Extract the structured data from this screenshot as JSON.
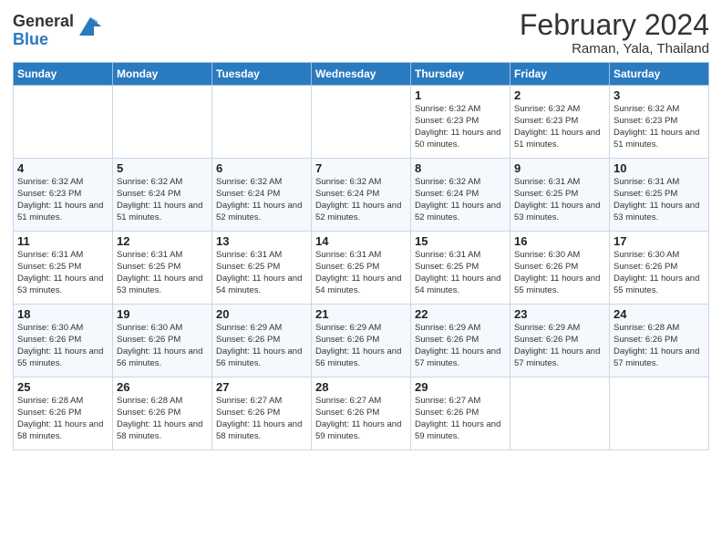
{
  "header": {
    "logo_general": "General",
    "logo_blue": "Blue",
    "month_year": "February 2024",
    "location": "Raman, Yala, Thailand"
  },
  "weekdays": [
    "Sunday",
    "Monday",
    "Tuesday",
    "Wednesday",
    "Thursday",
    "Friday",
    "Saturday"
  ],
  "weeks": [
    [
      {
        "day": "",
        "info": ""
      },
      {
        "day": "",
        "info": ""
      },
      {
        "day": "",
        "info": ""
      },
      {
        "day": "",
        "info": ""
      },
      {
        "day": "1",
        "info": "Sunrise: 6:32 AM\nSunset: 6:23 PM\nDaylight: 11 hours\nand 50 minutes."
      },
      {
        "day": "2",
        "info": "Sunrise: 6:32 AM\nSunset: 6:23 PM\nDaylight: 11 hours\nand 51 minutes."
      },
      {
        "day": "3",
        "info": "Sunrise: 6:32 AM\nSunset: 6:23 PM\nDaylight: 11 hours\nand 51 minutes."
      }
    ],
    [
      {
        "day": "4",
        "info": "Sunrise: 6:32 AM\nSunset: 6:23 PM\nDaylight: 11 hours\nand 51 minutes."
      },
      {
        "day": "5",
        "info": "Sunrise: 6:32 AM\nSunset: 6:24 PM\nDaylight: 11 hours\nand 51 minutes."
      },
      {
        "day": "6",
        "info": "Sunrise: 6:32 AM\nSunset: 6:24 PM\nDaylight: 11 hours\nand 52 minutes."
      },
      {
        "day": "7",
        "info": "Sunrise: 6:32 AM\nSunset: 6:24 PM\nDaylight: 11 hours\nand 52 minutes."
      },
      {
        "day": "8",
        "info": "Sunrise: 6:32 AM\nSunset: 6:24 PM\nDaylight: 11 hours\nand 52 minutes."
      },
      {
        "day": "9",
        "info": "Sunrise: 6:31 AM\nSunset: 6:25 PM\nDaylight: 11 hours\nand 53 minutes."
      },
      {
        "day": "10",
        "info": "Sunrise: 6:31 AM\nSunset: 6:25 PM\nDaylight: 11 hours\nand 53 minutes."
      }
    ],
    [
      {
        "day": "11",
        "info": "Sunrise: 6:31 AM\nSunset: 6:25 PM\nDaylight: 11 hours\nand 53 minutes."
      },
      {
        "day": "12",
        "info": "Sunrise: 6:31 AM\nSunset: 6:25 PM\nDaylight: 11 hours\nand 53 minutes."
      },
      {
        "day": "13",
        "info": "Sunrise: 6:31 AM\nSunset: 6:25 PM\nDaylight: 11 hours\nand 54 minutes."
      },
      {
        "day": "14",
        "info": "Sunrise: 6:31 AM\nSunset: 6:25 PM\nDaylight: 11 hours\nand 54 minutes."
      },
      {
        "day": "15",
        "info": "Sunrise: 6:31 AM\nSunset: 6:25 PM\nDaylight: 11 hours\nand 54 minutes."
      },
      {
        "day": "16",
        "info": "Sunrise: 6:30 AM\nSunset: 6:26 PM\nDaylight: 11 hours\nand 55 minutes."
      },
      {
        "day": "17",
        "info": "Sunrise: 6:30 AM\nSunset: 6:26 PM\nDaylight: 11 hours\nand 55 minutes."
      }
    ],
    [
      {
        "day": "18",
        "info": "Sunrise: 6:30 AM\nSunset: 6:26 PM\nDaylight: 11 hours\nand 55 minutes."
      },
      {
        "day": "19",
        "info": "Sunrise: 6:30 AM\nSunset: 6:26 PM\nDaylight: 11 hours\nand 56 minutes."
      },
      {
        "day": "20",
        "info": "Sunrise: 6:29 AM\nSunset: 6:26 PM\nDaylight: 11 hours\nand 56 minutes."
      },
      {
        "day": "21",
        "info": "Sunrise: 6:29 AM\nSunset: 6:26 PM\nDaylight: 11 hours\nand 56 minutes."
      },
      {
        "day": "22",
        "info": "Sunrise: 6:29 AM\nSunset: 6:26 PM\nDaylight: 11 hours\nand 57 minutes."
      },
      {
        "day": "23",
        "info": "Sunrise: 6:29 AM\nSunset: 6:26 PM\nDaylight: 11 hours\nand 57 minutes."
      },
      {
        "day": "24",
        "info": "Sunrise: 6:28 AM\nSunset: 6:26 PM\nDaylight: 11 hours\nand 57 minutes."
      }
    ],
    [
      {
        "day": "25",
        "info": "Sunrise: 6:28 AM\nSunset: 6:26 PM\nDaylight: 11 hours\nand 58 minutes."
      },
      {
        "day": "26",
        "info": "Sunrise: 6:28 AM\nSunset: 6:26 PM\nDaylight: 11 hours\nand 58 minutes."
      },
      {
        "day": "27",
        "info": "Sunrise: 6:27 AM\nSunset: 6:26 PM\nDaylight: 11 hours\nand 58 minutes."
      },
      {
        "day": "28",
        "info": "Sunrise: 6:27 AM\nSunset: 6:26 PM\nDaylight: 11 hours\nand 59 minutes."
      },
      {
        "day": "29",
        "info": "Sunrise: 6:27 AM\nSunset: 6:26 PM\nDaylight: 11 hours\nand 59 minutes."
      },
      {
        "day": "",
        "info": ""
      },
      {
        "day": "",
        "info": ""
      }
    ]
  ]
}
